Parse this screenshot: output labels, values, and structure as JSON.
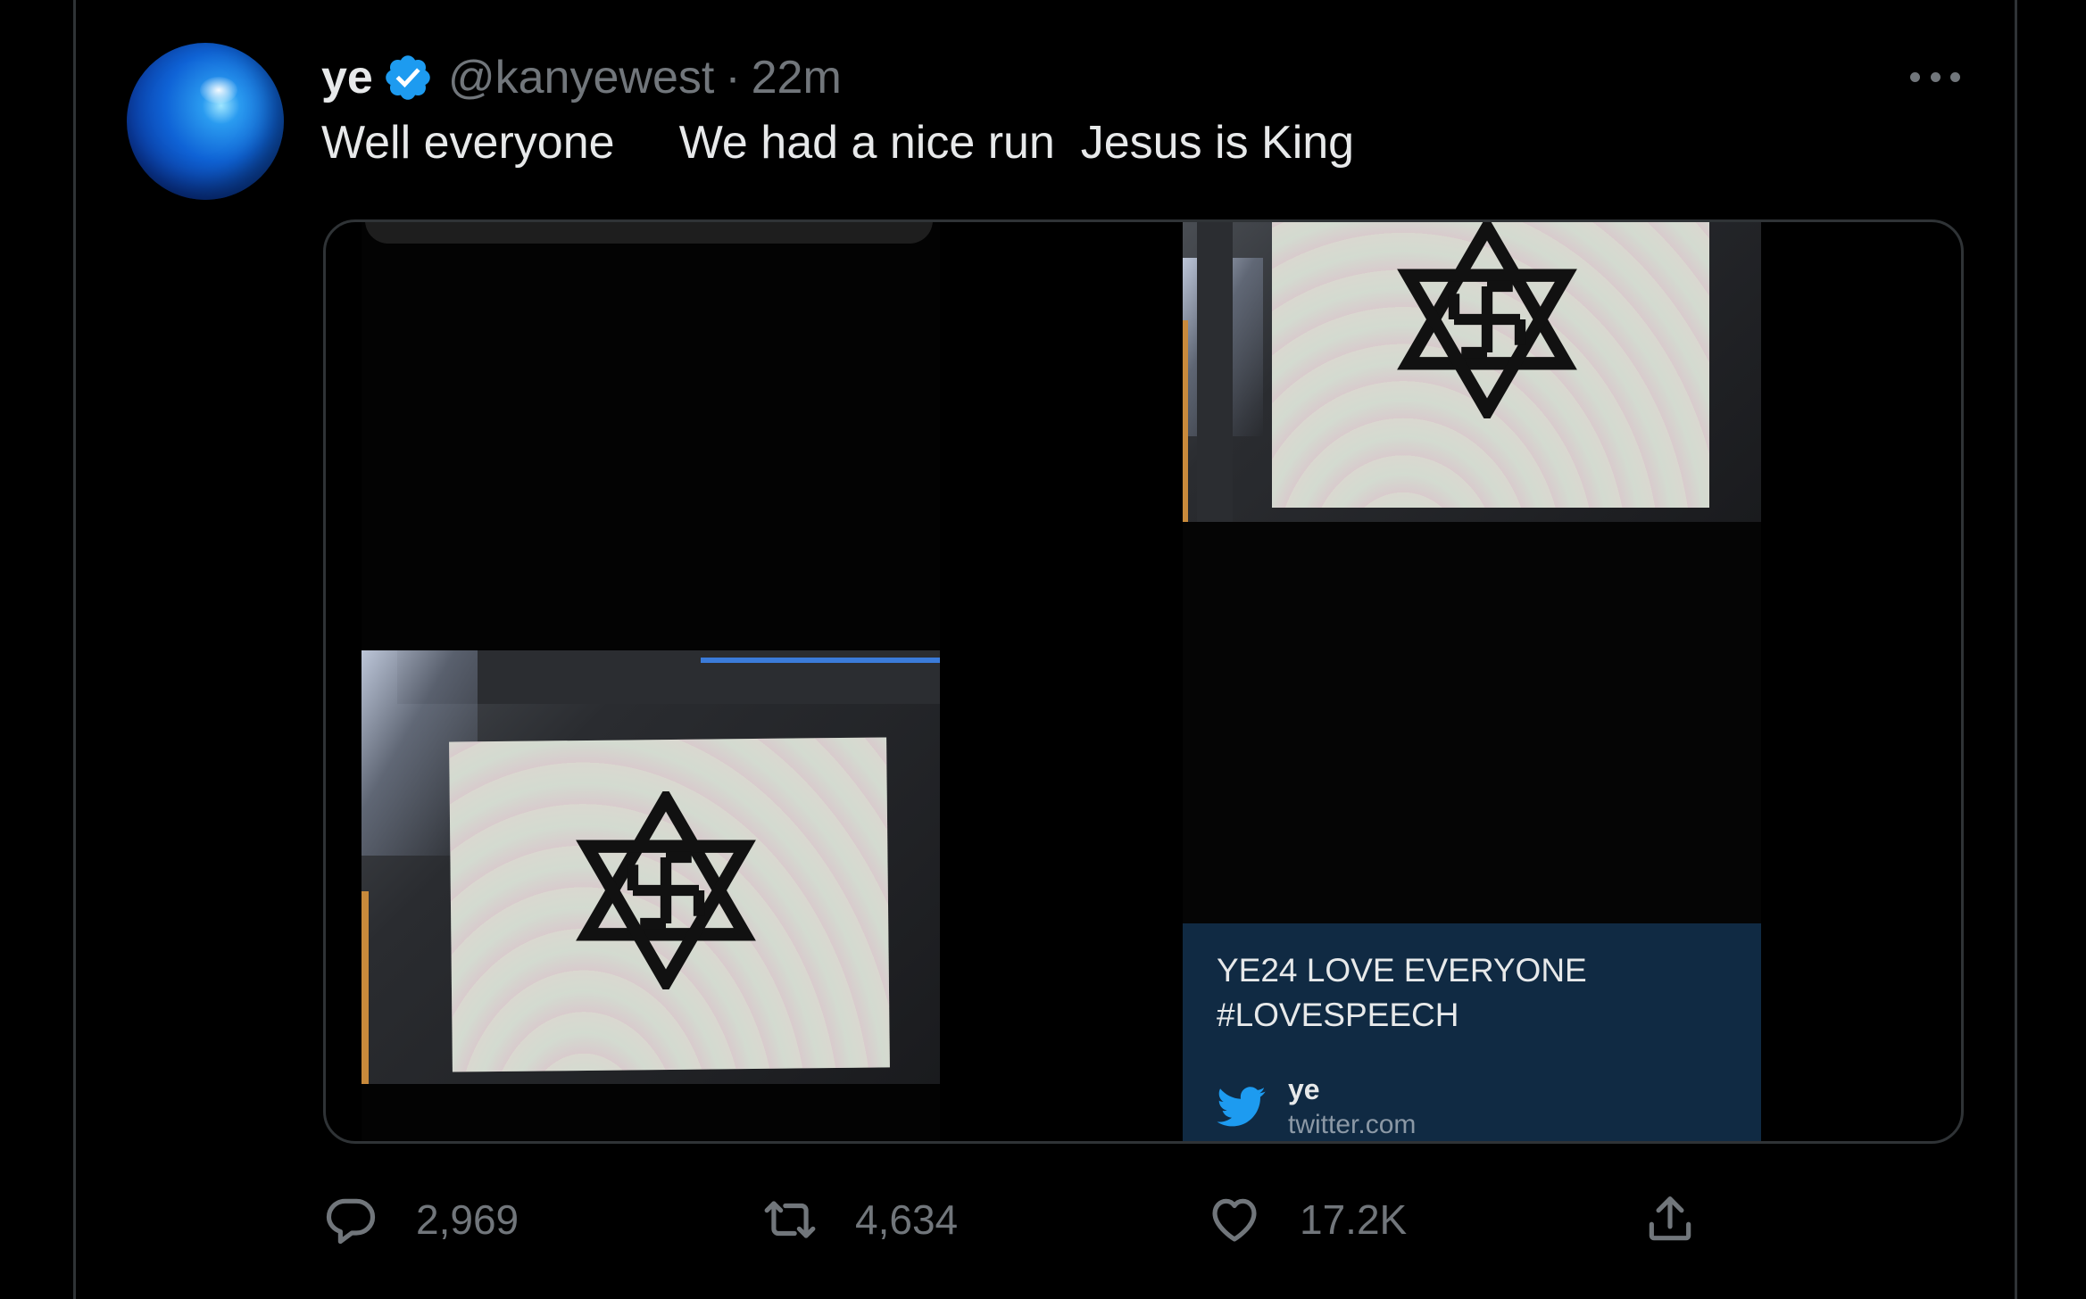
{
  "tweet": {
    "author_name": "ye",
    "handle": "@kanyewest",
    "separator": "·",
    "time": "22m",
    "text": "Well everyone     We had a nice run  Jesus is King"
  },
  "link_card": {
    "title_line1": "YE24 LOVE EVERYONE",
    "title_line2": "#LOVESPEECH",
    "source_name": "ye",
    "source_domain": "twitter.com"
  },
  "actions": {
    "replies": "2,969",
    "retweets": "4,634",
    "likes": "17.2K"
  },
  "colors": {
    "background": "#000000",
    "text": "#e7e9ea",
    "muted": "#71767b",
    "verified": "#1d9bf0",
    "card_background": "#102a43",
    "twitter_blue": "#1d9bf0"
  },
  "icons": [
    "verified-badge-icon",
    "more-icon",
    "twitter-bird-icon",
    "reply-icon",
    "retweet-icon",
    "like-icon",
    "share-icon"
  ]
}
